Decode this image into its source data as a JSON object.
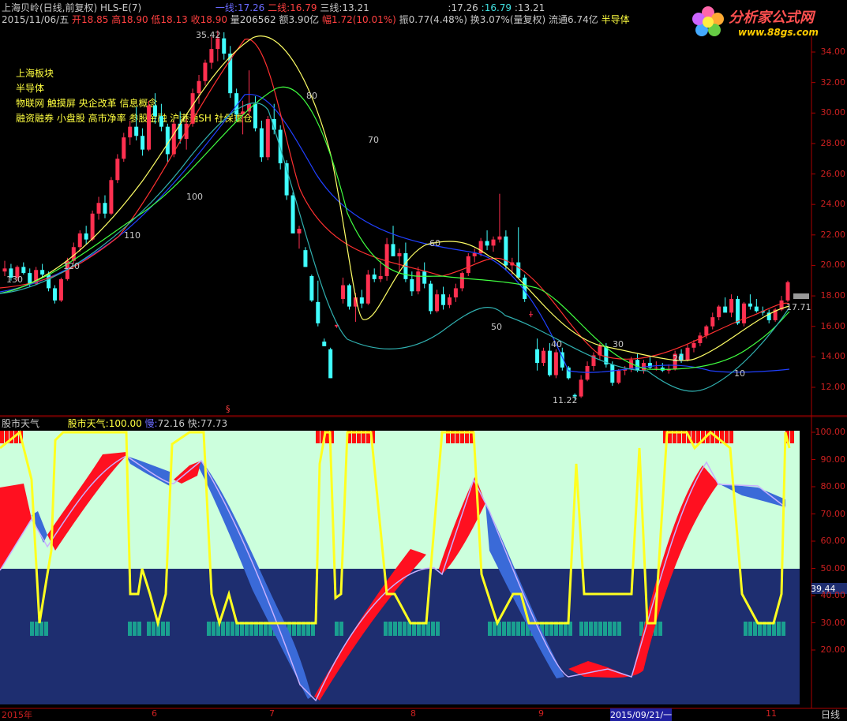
{
  "header": {
    "line1": {
      "title": "上海贝岭(日线,前复权) HLS-E(7)",
      "line1_label": "一线:",
      "line1_val": "17.26",
      "line2_label": "二线:",
      "line2_val": "16.79",
      "line3_label": "三线:",
      "line3_val": "13.21",
      "right_a": ":17.26",
      "right_b": ":16.79",
      "right_c": ":13.21"
    },
    "line2": {
      "date": "2015/11/06/五",
      "open": "开18.85",
      "high": "高18.90",
      "low": "低18.13",
      "close": "收18.90",
      "volume": "量206562",
      "amount": "额3.90亿",
      "change": "幅1.72(10.01%)",
      "amplitude": "振0.77(4.48%)",
      "turnover": "换3.07%(量复权)",
      "float": "流通6.74亿",
      "industry": "半导体"
    }
  },
  "logo": {
    "name": "分析家公式网",
    "url": "www.88gs.com"
  },
  "sectors": [
    "上海板块",
    "半导体",
    "物联网 触摸屏 央企改革 信息概念",
    "融资融券 小盘股 高市净率 参股金融 沪港通SH 社保重仓"
  ],
  "price_axis": [
    "34.00",
    "32.00",
    "30.00",
    "28.00",
    "26.00",
    "24.00",
    "22.00",
    "20.00",
    "18.00",
    "16.00",
    "14.00",
    "12.00"
  ],
  "annotations": {
    "high": "35.42",
    "low": "11.22",
    "last": "17.71",
    "wave_labels": [
      "80",
      "70",
      "100",
      "110",
      "120",
      "130",
      "60",
      "50",
      "40",
      "30",
      "20",
      "10"
    ]
  },
  "indicator": {
    "name": "股市天气",
    "label": "股市天气:",
    "value": "100.00",
    "slow_label": "慢:",
    "slow_value": "72.16",
    "fast_label": "快:",
    "fast_value": "77.73",
    "axis": [
      "100.00",
      "90.00",
      "80.00",
      "70.00",
      "60.00",
      "50.00",
      "40.00",
      "30.00",
      "20.00"
    ],
    "current": "39.44"
  },
  "date_axis": [
    "2015年",
    "6",
    "7",
    "8",
    "9",
    "2015/09/21/一",
    "11"
  ],
  "period": "日线",
  "colors": {
    "up": "#ff3050",
    "down": "#40ffff",
    "ma_yellow": "#ffff40",
    "upper_band": "#ccffdd",
    "lower_band": "#1e2e70"
  },
  "chart_data": {
    "type": "candlestick",
    "y_range": [
      11,
      35.5
    ],
    "series": [
      {
        "name": "一线",
        "values": [
          17.26
        ]
      },
      {
        "name": "二线",
        "values": [
          16.79
        ]
      },
      {
        "name": "三线",
        "values": [
          13.21
        ]
      }
    ],
    "ohlc": [
      [
        19.6,
        20.3,
        19.3,
        19.8
      ],
      [
        19.8,
        20.1,
        19.0,
        19.2
      ],
      [
        19.2,
        20.0,
        19.0,
        19.9
      ],
      [
        19.9,
        20.2,
        19.4,
        19.5
      ],
      [
        19.5,
        19.8,
        18.6,
        18.8
      ],
      [
        18.8,
        19.9,
        18.7,
        19.7
      ],
      [
        19.7,
        20.1,
        19.2,
        19.4
      ],
      [
        19.4,
        19.6,
        18.3,
        18.5
      ],
      [
        18.5,
        18.7,
        17.5,
        17.7
      ],
      [
        17.7,
        19.2,
        17.6,
        19.1
      ],
      [
        19.1,
        20.5,
        19.0,
        20.3
      ],
      [
        20.3,
        21.5,
        20.1,
        21.2
      ],
      [
        21.2,
        22.3,
        20.9,
        22.1
      ],
      [
        22.1,
        22.6,
        21.4,
        21.7
      ],
      [
        21.7,
        23.6,
        21.6,
        23.4
      ],
      [
        23.4,
        24.5,
        23.0,
        24.1
      ],
      [
        24.1,
        24.6,
        23.1,
        23.4
      ],
      [
        23.4,
        25.8,
        23.3,
        25.6
      ],
      [
        25.6,
        27.3,
        25.4,
        27.0
      ],
      [
        27.0,
        28.7,
        26.8,
        28.4
      ],
      [
        28.4,
        29.5,
        27.9,
        29.1
      ],
      [
        29.1,
        30.4,
        28.2,
        28.5
      ],
      [
        28.5,
        29.0,
        27.2,
        27.6
      ],
      [
        27.6,
        30.8,
        27.5,
        30.5
      ],
      [
        30.5,
        31.3,
        29.3,
        29.8
      ],
      [
        29.8,
        30.6,
        28.8,
        29.1
      ],
      [
        29.1,
        29.3,
        26.8,
        27.3
      ],
      [
        27.3,
        29.5,
        27.1,
        29.3
      ],
      [
        29.3,
        30.1,
        28.0,
        28.3
      ],
      [
        28.3,
        29.6,
        27.6,
        29.3
      ],
      [
        29.3,
        31.6,
        29.1,
        31.3
      ],
      [
        31.3,
        32.5,
        30.6,
        32.1
      ],
      [
        32.1,
        33.5,
        31.8,
        33.3
      ],
      [
        33.3,
        35.0,
        32.9,
        34.2
      ],
      [
        34.2,
        35.42,
        33.4,
        34.9
      ],
      [
        34.9,
        35.3,
        33.5,
        33.9
      ],
      [
        33.9,
        34.4,
        31.0,
        31.3
      ],
      [
        31.3,
        31.6,
        29.5,
        29.9
      ],
      [
        29.9,
        30.8,
        28.6,
        30.1
      ],
      [
        30.1,
        32.8,
        29.8,
        30.6
      ],
      [
        30.6,
        31.1,
        28.8,
        29.0
      ],
      [
        29.0,
        29.5,
        26.8,
        27.1
      ],
      [
        27.1,
        29.8,
        26.9,
        29.6
      ],
      [
        29.6,
        30.6,
        28.6,
        28.9
      ],
      [
        28.9,
        29.2,
        26.3,
        26.7
      ],
      [
        26.7,
        26.9,
        24.3,
        24.6
      ],
      [
        24.6,
        24.8,
        22.3,
        22.1
      ],
      [
        22.1,
        22.6,
        21.1,
        22.4
      ],
      [
        21.0,
        21.2,
        19.9,
        19.9
      ],
      [
        19.3,
        19.4,
        17.6,
        17.7
      ],
      [
        17.6,
        19.0,
        16.0,
        16.2
      ],
      [
        15.0,
        15.2,
        14.7,
        14.7
      ],
      [
        14.5,
        14.6,
        12.6,
        12.6
      ],
      [
        16.0,
        16.1,
        15.9,
        16.1
      ],
      [
        17.8,
        19.2,
        17.5,
        18.7
      ],
      [
        18.7,
        18.8,
        17.1,
        17.3
      ],
      [
        17.3,
        18.2,
        16.3,
        17.9
      ],
      [
        17.9,
        18.4,
        17.2,
        17.5
      ],
      [
        17.5,
        19.7,
        17.4,
        19.4
      ],
      [
        19.4,
        19.8,
        18.9,
        19.1
      ],
      [
        19.1,
        20.3,
        18.9,
        19.3
      ],
      [
        19.3,
        21.8,
        19.0,
        21.4
      ],
      [
        21.4,
        22.6,
        20.8,
        20.6
      ],
      [
        20.6,
        21.1,
        19.6,
        20.8
      ],
      [
        20.8,
        21.5,
        18.9,
        19.1
      ],
      [
        19.1,
        19.6,
        18.0,
        18.3
      ],
      [
        18.3,
        19.9,
        18.1,
        19.6
      ],
      [
        19.6,
        20.2,
        18.5,
        18.8
      ],
      [
        18.8,
        19.0,
        16.8,
        17.0
      ],
      [
        17.0,
        18.4,
        16.9,
        18.1
      ],
      [
        18.1,
        18.6,
        17.1,
        17.4
      ],
      [
        17.4,
        18.1,
        17.2,
        17.9
      ],
      [
        17.9,
        18.8,
        17.6,
        18.5
      ],
      [
        18.5,
        19.6,
        18.3,
        19.5
      ],
      [
        19.5,
        20.8,
        19.3,
        20.6
      ],
      [
        20.6,
        21.1,
        20.2,
        20.8
      ],
      [
        20.8,
        21.8,
        20.6,
        21.6
      ],
      [
        21.6,
        22.3,
        21.0,
        21.3
      ],
      [
        21.3,
        21.9,
        20.9,
        21.7
      ],
      [
        21.7,
        24.7,
        21.5,
        21.9
      ],
      [
        21.9,
        22.3,
        19.7,
        20.0
      ],
      [
        20.0,
        20.5,
        19.4,
        20.2
      ],
      [
        20.2,
        22.5,
        20.0,
        19.2
      ],
      [
        19.2,
        19.4,
        17.6,
        17.8
      ],
      [
        16.8,
        17.0,
        16.6,
        16.8
      ],
      [
        14.5,
        15.2,
        13.1,
        13.6
      ],
      [
        13.6,
        14.6,
        13.4,
        14.4
      ],
      [
        14.4,
        14.9,
        12.7,
        12.8
      ],
      [
        12.8,
        14.5,
        12.6,
        14.3
      ],
      [
        14.3,
        14.6,
        13.1,
        13.3
      ],
      [
        13.3,
        13.4,
        12.5,
        12.6
      ],
      [
        11.5,
        11.6,
        11.2,
        11.4
      ],
      [
        11.4,
        12.8,
        11.3,
        12.5
      ],
      [
        12.5,
        13.7,
        12.4,
        13.4
      ],
      [
        13.4,
        14.3,
        13.1,
        14.1
      ],
      [
        14.1,
        14.9,
        13.8,
        14.7
      ],
      [
        14.7,
        14.9,
        13.3,
        13.5
      ],
      [
        13.5,
        13.7,
        12.1,
        12.3
      ],
      [
        12.3,
        13.2,
        12.2,
        13.1
      ],
      [
        13.1,
        13.4,
        12.8,
        13.2
      ],
      [
        13.2,
        14.0,
        13.0,
        13.8
      ],
      [
        13.8,
        14.2,
        13.0,
        13.1
      ],
      [
        13.1,
        13.8,
        12.9,
        13.6
      ],
      [
        13.6,
        14.0,
        13.2,
        13.3
      ],
      [
        13.3,
        13.7,
        13.1,
        13.3
      ],
      [
        13.3,
        13.6,
        13.0,
        13.1
      ],
      [
        13.1,
        13.5,
        12.9,
        13.2
      ],
      [
        13.2,
        14.4,
        13.1,
        14.2
      ],
      [
        14.2,
        14.5,
        13.6,
        13.8
      ],
      [
        13.8,
        14.8,
        13.7,
        14.6
      ],
      [
        14.6,
        15.1,
        14.3,
        14.9
      ],
      [
        14.9,
        15.6,
        14.7,
        15.4
      ],
      [
        15.4,
        16.1,
        15.2,
        16.0
      ],
      [
        16.0,
        16.9,
        15.8,
        16.6
      ],
      [
        16.6,
        17.4,
        16.4,
        17.3
      ],
      [
        17.3,
        17.9,
        17.0,
        16.9
      ],
      [
        16.9,
        18.1,
        16.6,
        17.8
      ],
      [
        17.8,
        18.0,
        16.1,
        16.2
      ],
      [
        16.2,
        17.6,
        16.0,
        17.5
      ],
      [
        17.5,
        18.1,
        17.1,
        17.3
      ],
      [
        17.3,
        17.8,
        16.9,
        17.0
      ],
      [
        17.0,
        17.3,
        16.7,
        16.9
      ],
      [
        16.9,
        17.1,
        16.2,
        16.4
      ],
      [
        16.4,
        17.2,
        16.3,
        17.1
      ],
      [
        17.1,
        18.0,
        17.0,
        17.7
      ],
      [
        17.7,
        19.0,
        17.6,
        18.9
      ]
    ]
  }
}
